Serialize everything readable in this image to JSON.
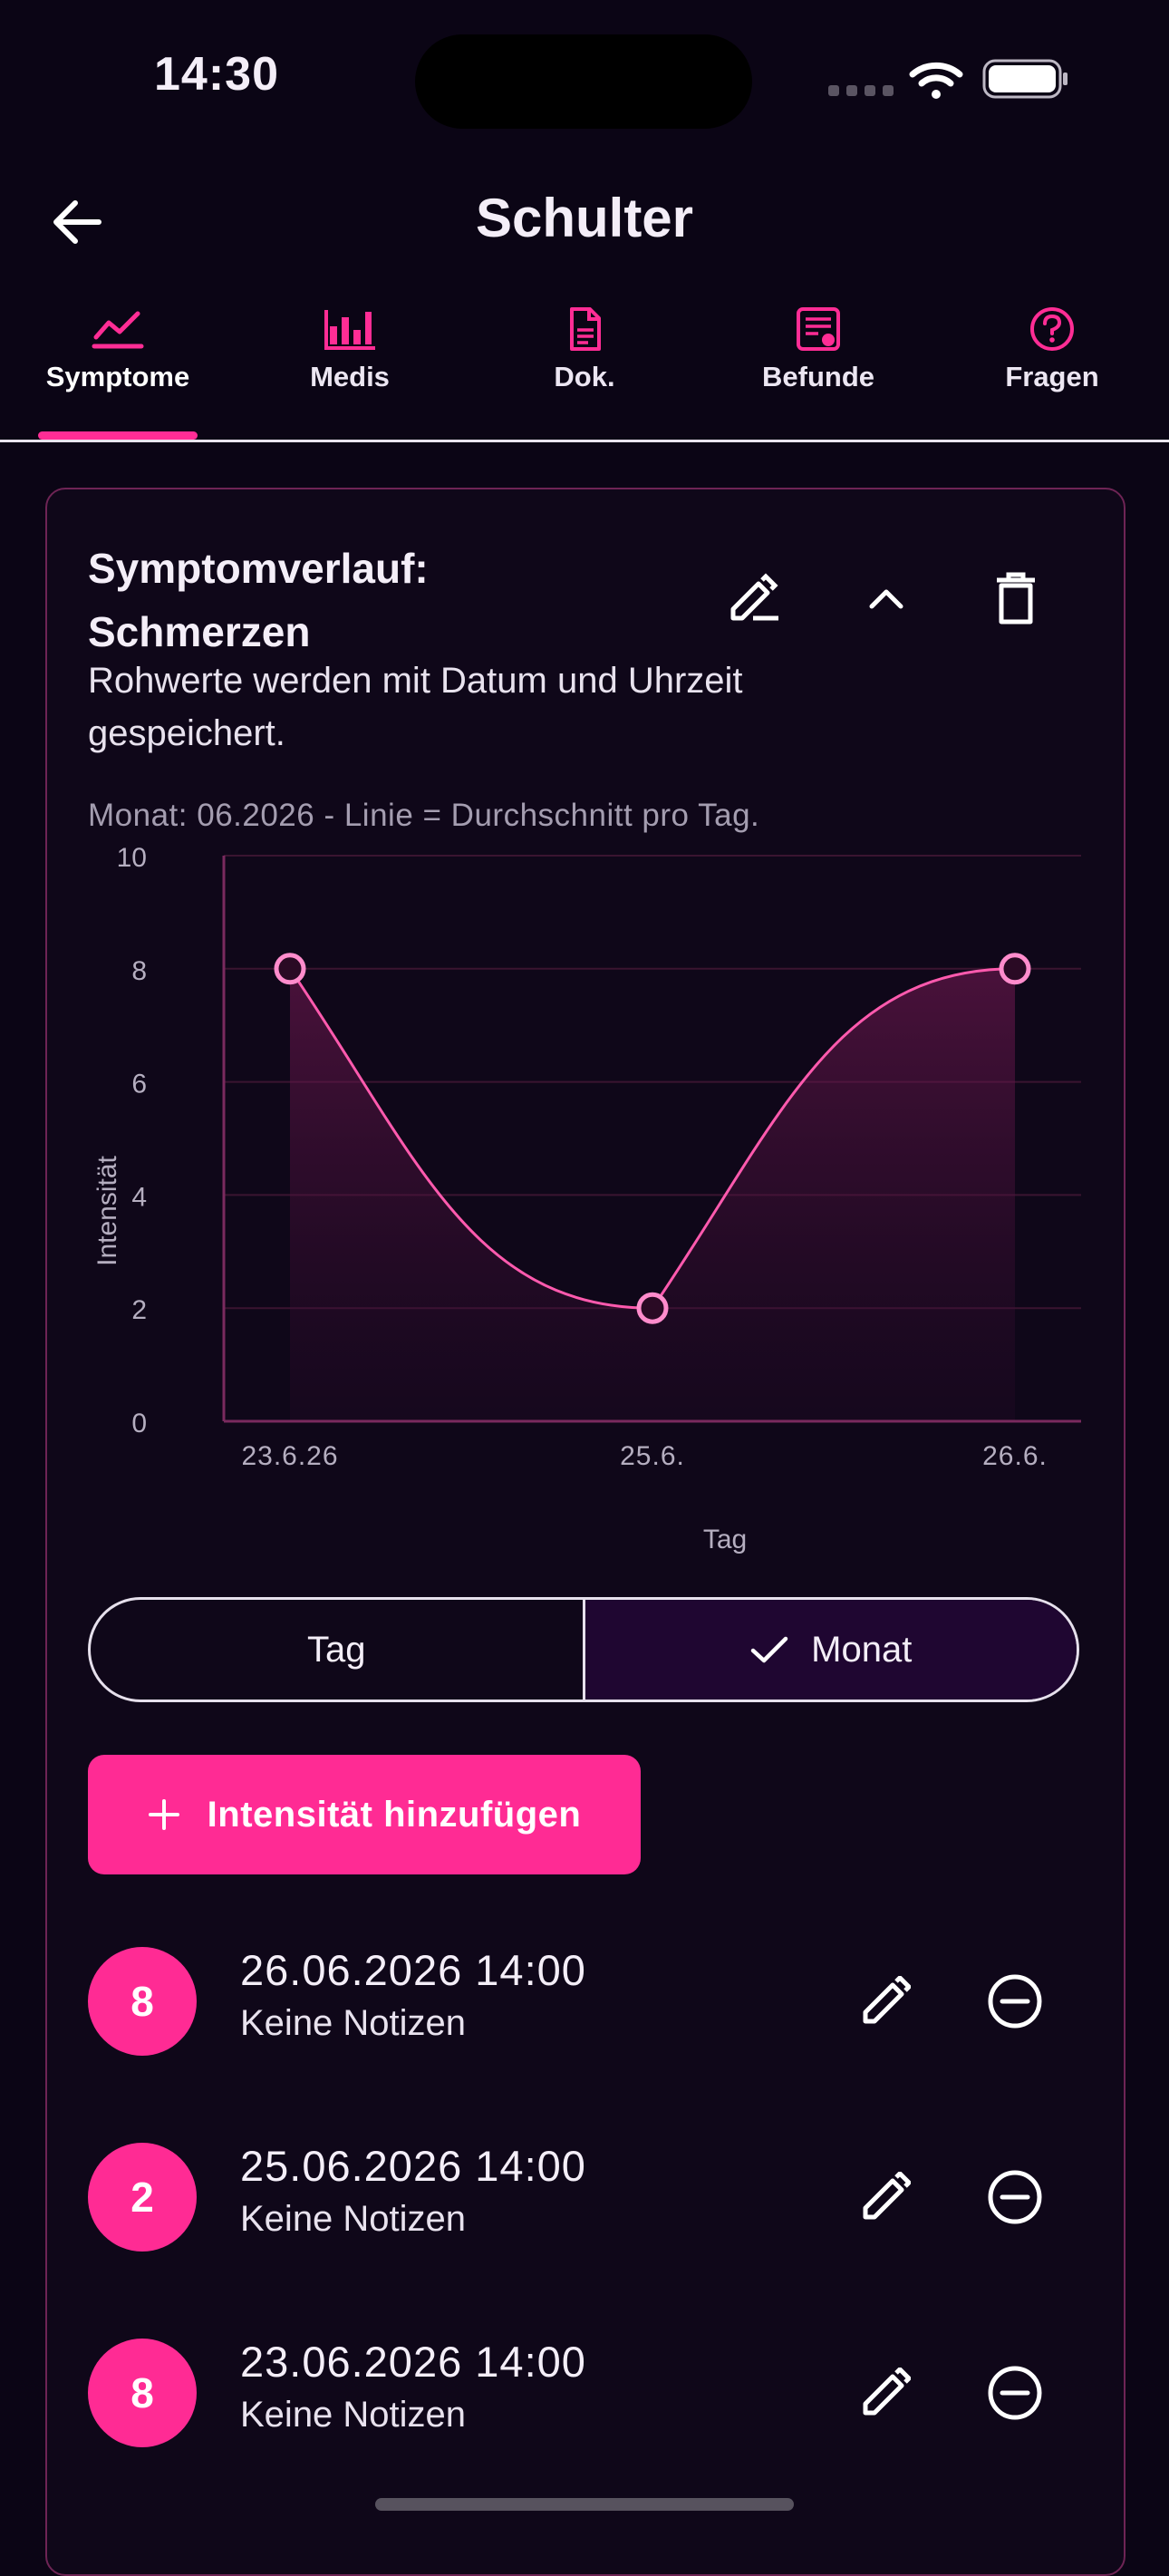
{
  "status_bar": {
    "time": "14:30"
  },
  "header": {
    "title": "Schulter"
  },
  "tabs": [
    {
      "label": "Symptome",
      "icon": "line-chart-icon",
      "active": true
    },
    {
      "label": "Medis",
      "icon": "bar-chart-icon",
      "active": false
    },
    {
      "label": "Dok.",
      "icon": "document-icon",
      "active": false
    },
    {
      "label": "Befunde",
      "icon": "report-icon",
      "active": false
    },
    {
      "label": "Fragen",
      "icon": "help-circle-icon",
      "active": false
    }
  ],
  "card": {
    "title": "Symptomverlauf: Schmerzen",
    "subtitle": "Rohwerte werden mit Datum und Uhrzeit gespeichert.",
    "caption": "Monat: 06.2026 - Linie = Durchschnitt pro Tag."
  },
  "chart_data": {
    "type": "area",
    "x": [
      "23.6.26",
      "25.6.",
      "26.6."
    ],
    "values": [
      8,
      2,
      8
    ],
    "xlabel": "Tag",
    "ylabel": "Intensität",
    "ylim": [
      0,
      10
    ],
    "yticks": [
      0,
      2,
      4,
      6,
      8,
      10
    ],
    "grid": true
  },
  "segmented": {
    "left": "Tag",
    "right": "Monat",
    "selected": "Monat"
  },
  "add_button": {
    "label": "Intensität hinzufügen"
  },
  "entries": [
    {
      "value": "8",
      "datetime": "26.06.2026 14:00",
      "note": "Keine Notizen"
    },
    {
      "value": "2",
      "datetime": "25.06.2026 14:00",
      "note": "Keine Notizen"
    },
    {
      "value": "8",
      "datetime": "23.06.2026 14:00",
      "note": "Keine Notizen"
    }
  ],
  "colors": {
    "accent": "#ff2b94",
    "background": "#0b0515",
    "line": "#ff5aae"
  }
}
